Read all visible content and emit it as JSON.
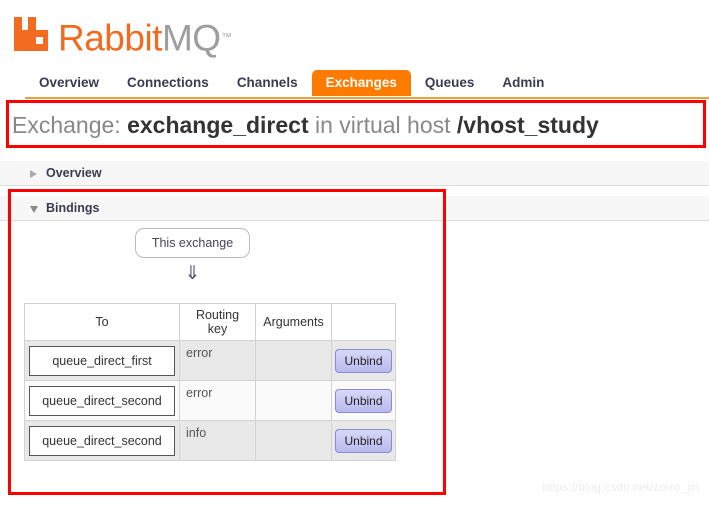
{
  "brand": {
    "name_primary": "Rabbit",
    "name_secondary": "MQ",
    "trademark": "™",
    "logo_icon": "rabbitmq-logo-icon",
    "primary_color": "#F26B21",
    "secondary_color": "#9E9E9E"
  },
  "nav": {
    "active": "Exchanges",
    "active_color": "#FF7B00",
    "rule_color": "#E8A33D",
    "tabs": [
      {
        "label": "Overview"
      },
      {
        "label": "Connections"
      },
      {
        "label": "Channels"
      },
      {
        "label": "Exchanges"
      },
      {
        "label": "Queues"
      },
      {
        "label": "Admin"
      }
    ]
  },
  "page_title": {
    "prefix": "Exchange:",
    "exchange_name": "exchange_direct",
    "middle": "in virtual host",
    "vhost": "/vhost_study"
  },
  "sections": {
    "overview": {
      "label": "Overview",
      "expanded": false,
      "triangle_icon": "triangle-right-icon"
    },
    "bindings": {
      "label": "Bindings",
      "expanded": true,
      "triangle_icon": "triangle-down-icon"
    }
  },
  "bindings": {
    "source_node_label": "This exchange",
    "arrow_glyph": "⇓",
    "arrow_icon": "double-arrow-down-icon",
    "columns": [
      "To",
      "Routing key",
      "Arguments",
      ""
    ],
    "rows": [
      {
        "to": "queue_direct_first",
        "routing_key": "error",
        "arguments": "",
        "action": "Unbind"
      },
      {
        "to": "queue_direct_second",
        "routing_key": "error",
        "arguments": "",
        "action": "Unbind"
      },
      {
        "to": "queue_direct_second",
        "routing_key": "info",
        "arguments": "",
        "action": "Unbind"
      }
    ]
  },
  "annotations": {
    "color": "#FF0000",
    "boxes": [
      {
        "name": "title-highlight"
      },
      {
        "name": "bindings-highlight"
      }
    ]
  },
  "watermark": {
    "text": "https://blog.csdn.net/zorro_jin"
  }
}
